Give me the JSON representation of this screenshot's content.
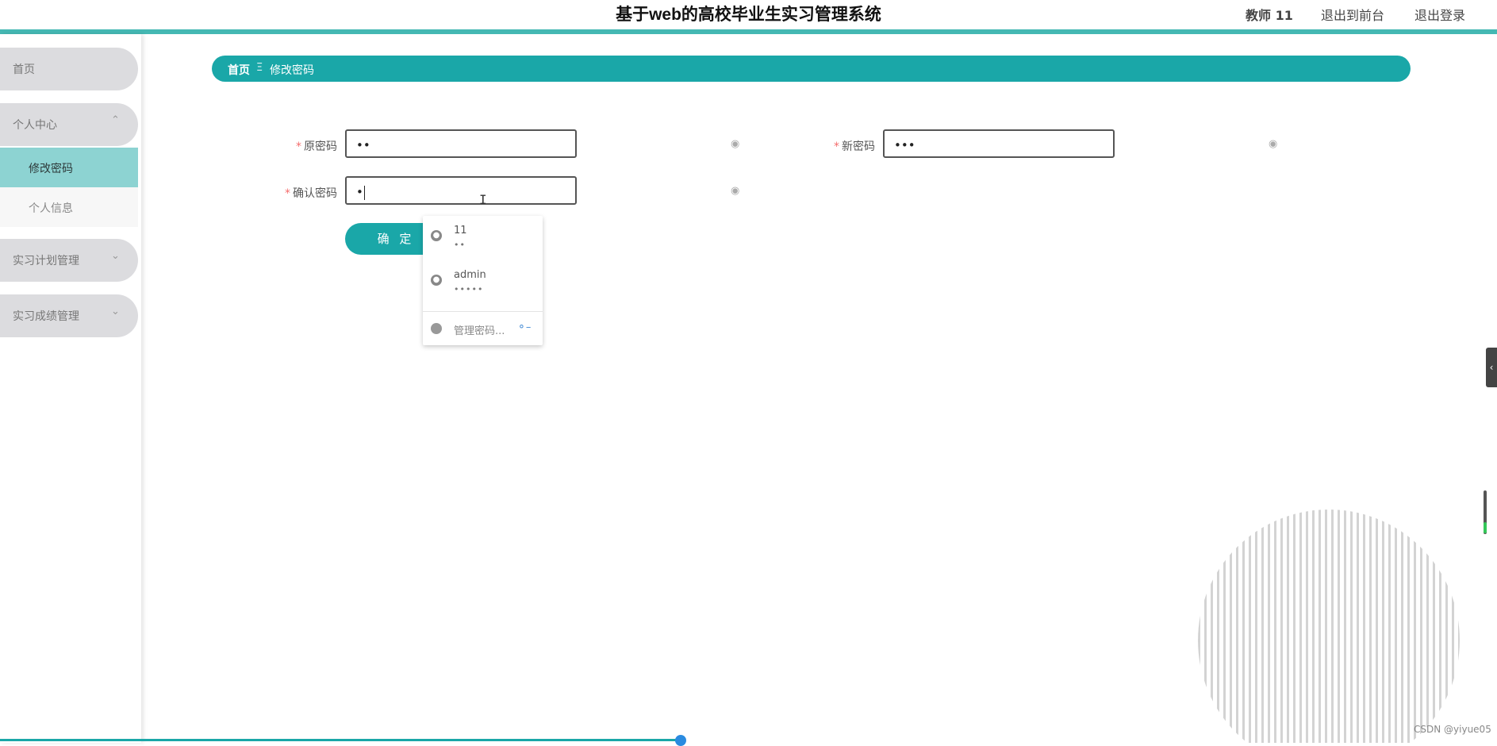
{
  "header": {
    "title": "基于web的高校毕业生实习管理系统",
    "user": "教师 11",
    "to_front": "退出到前台",
    "logout": "退出登录"
  },
  "sidebar": {
    "items": [
      {
        "label": "首页"
      },
      {
        "label": "个人中心",
        "chevron": "^"
      },
      {
        "label": "修改密码"
      },
      {
        "label": "个人信息"
      },
      {
        "label": "实习计划管理",
        "chevron": "v"
      },
      {
        "label": "实习成绩管理",
        "chevron": "v"
      }
    ]
  },
  "breadcrumb": {
    "home": "首页",
    "separator": "Ξ",
    "current": "修改密码"
  },
  "form": {
    "old_password": {
      "label": "原密码",
      "value": "••"
    },
    "new_password": {
      "label": "新密码",
      "value": "•••"
    },
    "confirm_password": {
      "label": "确认密码",
      "value": "•"
    },
    "required_mark": "*",
    "submit": "确 定"
  },
  "autofill": {
    "entries": [
      {
        "username": "11",
        "password": "••"
      },
      {
        "username": "admin",
        "password": "•••••"
      }
    ],
    "manage_label": "管理密码..."
  },
  "watermark": "CSDN @yiyue05",
  "colors": {
    "accent": "#1aa7a8",
    "header_line": "#45b8b3",
    "submenu_active": "#8dd3d2",
    "menu_bg": "#dcdcdf"
  }
}
